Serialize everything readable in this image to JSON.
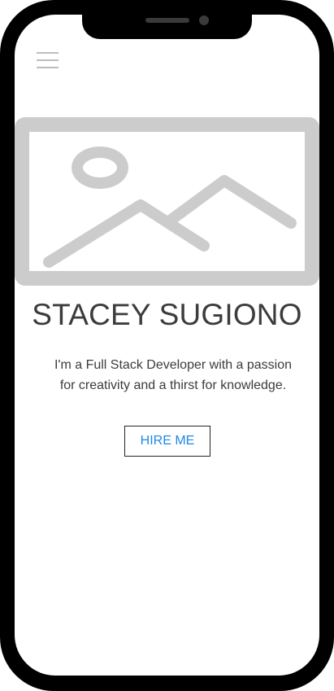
{
  "header": {
    "menu_icon": "hamburger-menu-icon"
  },
  "hero": {
    "image_icon": "image-placeholder-icon",
    "name": "STACEY SUGIONO",
    "tagline": "I'm a Full Stack Developer with a passion for creativity and a thirst for knowledge."
  },
  "cta": {
    "hire_label": "HIRE ME"
  },
  "colors": {
    "frame": "#000000",
    "text": "#3c3c3c",
    "accent": "#1e88e5",
    "placeholder": "#cccccc"
  }
}
